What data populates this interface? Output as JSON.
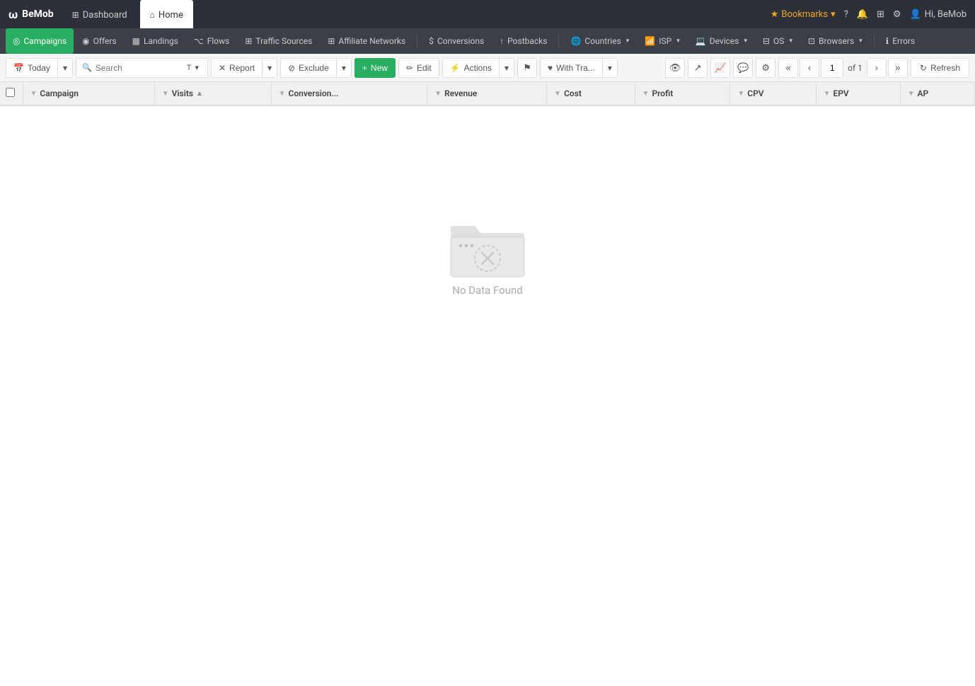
{
  "topBar": {
    "logo": "BeMob",
    "logo_icon": "ω",
    "tabs": [
      {
        "id": "dashboard",
        "label": "Dashboard",
        "icon": "⊞",
        "active": false
      },
      {
        "id": "home",
        "label": "Home",
        "icon": "⌂",
        "active": true
      }
    ],
    "bookmarks_label": "Bookmarks",
    "help_icon": "?",
    "user_label": "Hi, BeMob"
  },
  "navBar": {
    "items": [
      {
        "id": "campaigns",
        "label": "Campaigns",
        "icon": "◎",
        "active": true,
        "hasDropdown": false
      },
      {
        "id": "offers",
        "label": "Offers",
        "icon": "◉",
        "active": false,
        "hasDropdown": false
      },
      {
        "id": "landings",
        "label": "Landings",
        "icon": "▦",
        "active": false,
        "hasDropdown": false
      },
      {
        "id": "flows",
        "label": "Flows",
        "icon": "⌥",
        "active": false,
        "hasDropdown": false
      },
      {
        "id": "traffic-sources",
        "label": "Traffic Sources",
        "icon": "⊞",
        "active": false,
        "hasDropdown": false
      },
      {
        "id": "affiliate-networks",
        "label": "Affiliate Networks",
        "icon": "⊞",
        "active": false,
        "hasDropdown": false
      },
      {
        "id": "conversions",
        "label": "Conversions",
        "icon": "$",
        "active": false,
        "hasDropdown": false
      },
      {
        "id": "postbacks",
        "label": "Postbacks",
        "icon": "↑",
        "active": false,
        "hasDropdown": false
      },
      {
        "id": "countries",
        "label": "Countries",
        "icon": "🌐",
        "active": false,
        "hasDropdown": true
      },
      {
        "id": "isp",
        "label": "ISP",
        "icon": "📶",
        "active": false,
        "hasDropdown": true
      },
      {
        "id": "devices",
        "label": "Devices",
        "icon": "💻",
        "active": false,
        "hasDropdown": true
      },
      {
        "id": "os",
        "label": "OS",
        "icon": "⊟",
        "active": false,
        "hasDropdown": true
      },
      {
        "id": "browsers",
        "label": "Browsers",
        "icon": "⊡",
        "active": false,
        "hasDropdown": true
      },
      {
        "id": "errors",
        "label": "Errors",
        "icon": "ℹ",
        "active": false,
        "hasDropdown": false
      }
    ]
  },
  "toolbar": {
    "date_label": "Today",
    "search_placeholder": "Search",
    "search_type": "T",
    "report_label": "Report",
    "exclude_label": "Exclude",
    "new_label": "New",
    "edit_label": "Edit",
    "actions_label": "Actions",
    "flag_icon": "⚑",
    "with_tra_label": "With Tra...",
    "eye_icon": "👁",
    "share_icon": "↗",
    "chart_icon": "📊",
    "comment_icon": "💬",
    "settings_icon": "⚙",
    "page_current": "1",
    "page_total": "1",
    "refresh_label": "Refresh"
  },
  "table": {
    "columns": [
      {
        "id": "campaign",
        "label": "Campaign"
      },
      {
        "id": "visits",
        "label": "Visits"
      },
      {
        "id": "conversions",
        "label": "Conversion..."
      },
      {
        "id": "revenue",
        "label": "Revenue"
      },
      {
        "id": "cost",
        "label": "Cost"
      },
      {
        "id": "profit",
        "label": "Profit"
      },
      {
        "id": "cpv",
        "label": "CPV"
      },
      {
        "id": "epv",
        "label": "EPV"
      },
      {
        "id": "ap",
        "label": "AP"
      }
    ],
    "rows": [],
    "empty_message": "No Data Found"
  },
  "colors": {
    "topbar_bg": "#2c3038",
    "navbar_bg": "#3a3f48",
    "active_nav": "#27ae60",
    "toolbar_bg": "#f5f5f5",
    "table_header_bg": "#f0f0f0"
  }
}
